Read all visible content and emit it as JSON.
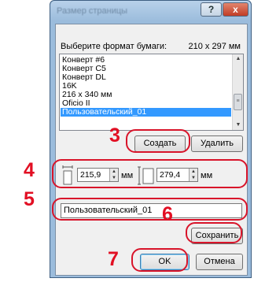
{
  "dialog": {
    "title": "Размер страницы",
    "help_symbol": "?",
    "close_symbol": "x"
  },
  "format": {
    "label": "Выберите формат бумаги:",
    "size": "210 x 297 мм"
  },
  "list": {
    "items": [
      "Конверт #6",
      "Конверт C5",
      "Конверт DL",
      "16K",
      "216 x 340 мм",
      "Oficio II",
      "Пользовательский_01"
    ],
    "selected_index": 6
  },
  "buttons": {
    "create": "Создать",
    "delete": "Удалить",
    "save": "Сохранить",
    "ok": "OK",
    "cancel": "Отмена"
  },
  "dimensions": {
    "width": "215,9",
    "width_unit": "мм",
    "height": "279,4",
    "height_unit": "мм"
  },
  "name_field": {
    "value": "Пользовательский_01"
  },
  "steps": [
    "3",
    "4",
    "5",
    "6",
    "7"
  ],
  "colors": {
    "callout": "#d8142a",
    "step_number": "#e20f23",
    "selection": "#3399ff"
  }
}
